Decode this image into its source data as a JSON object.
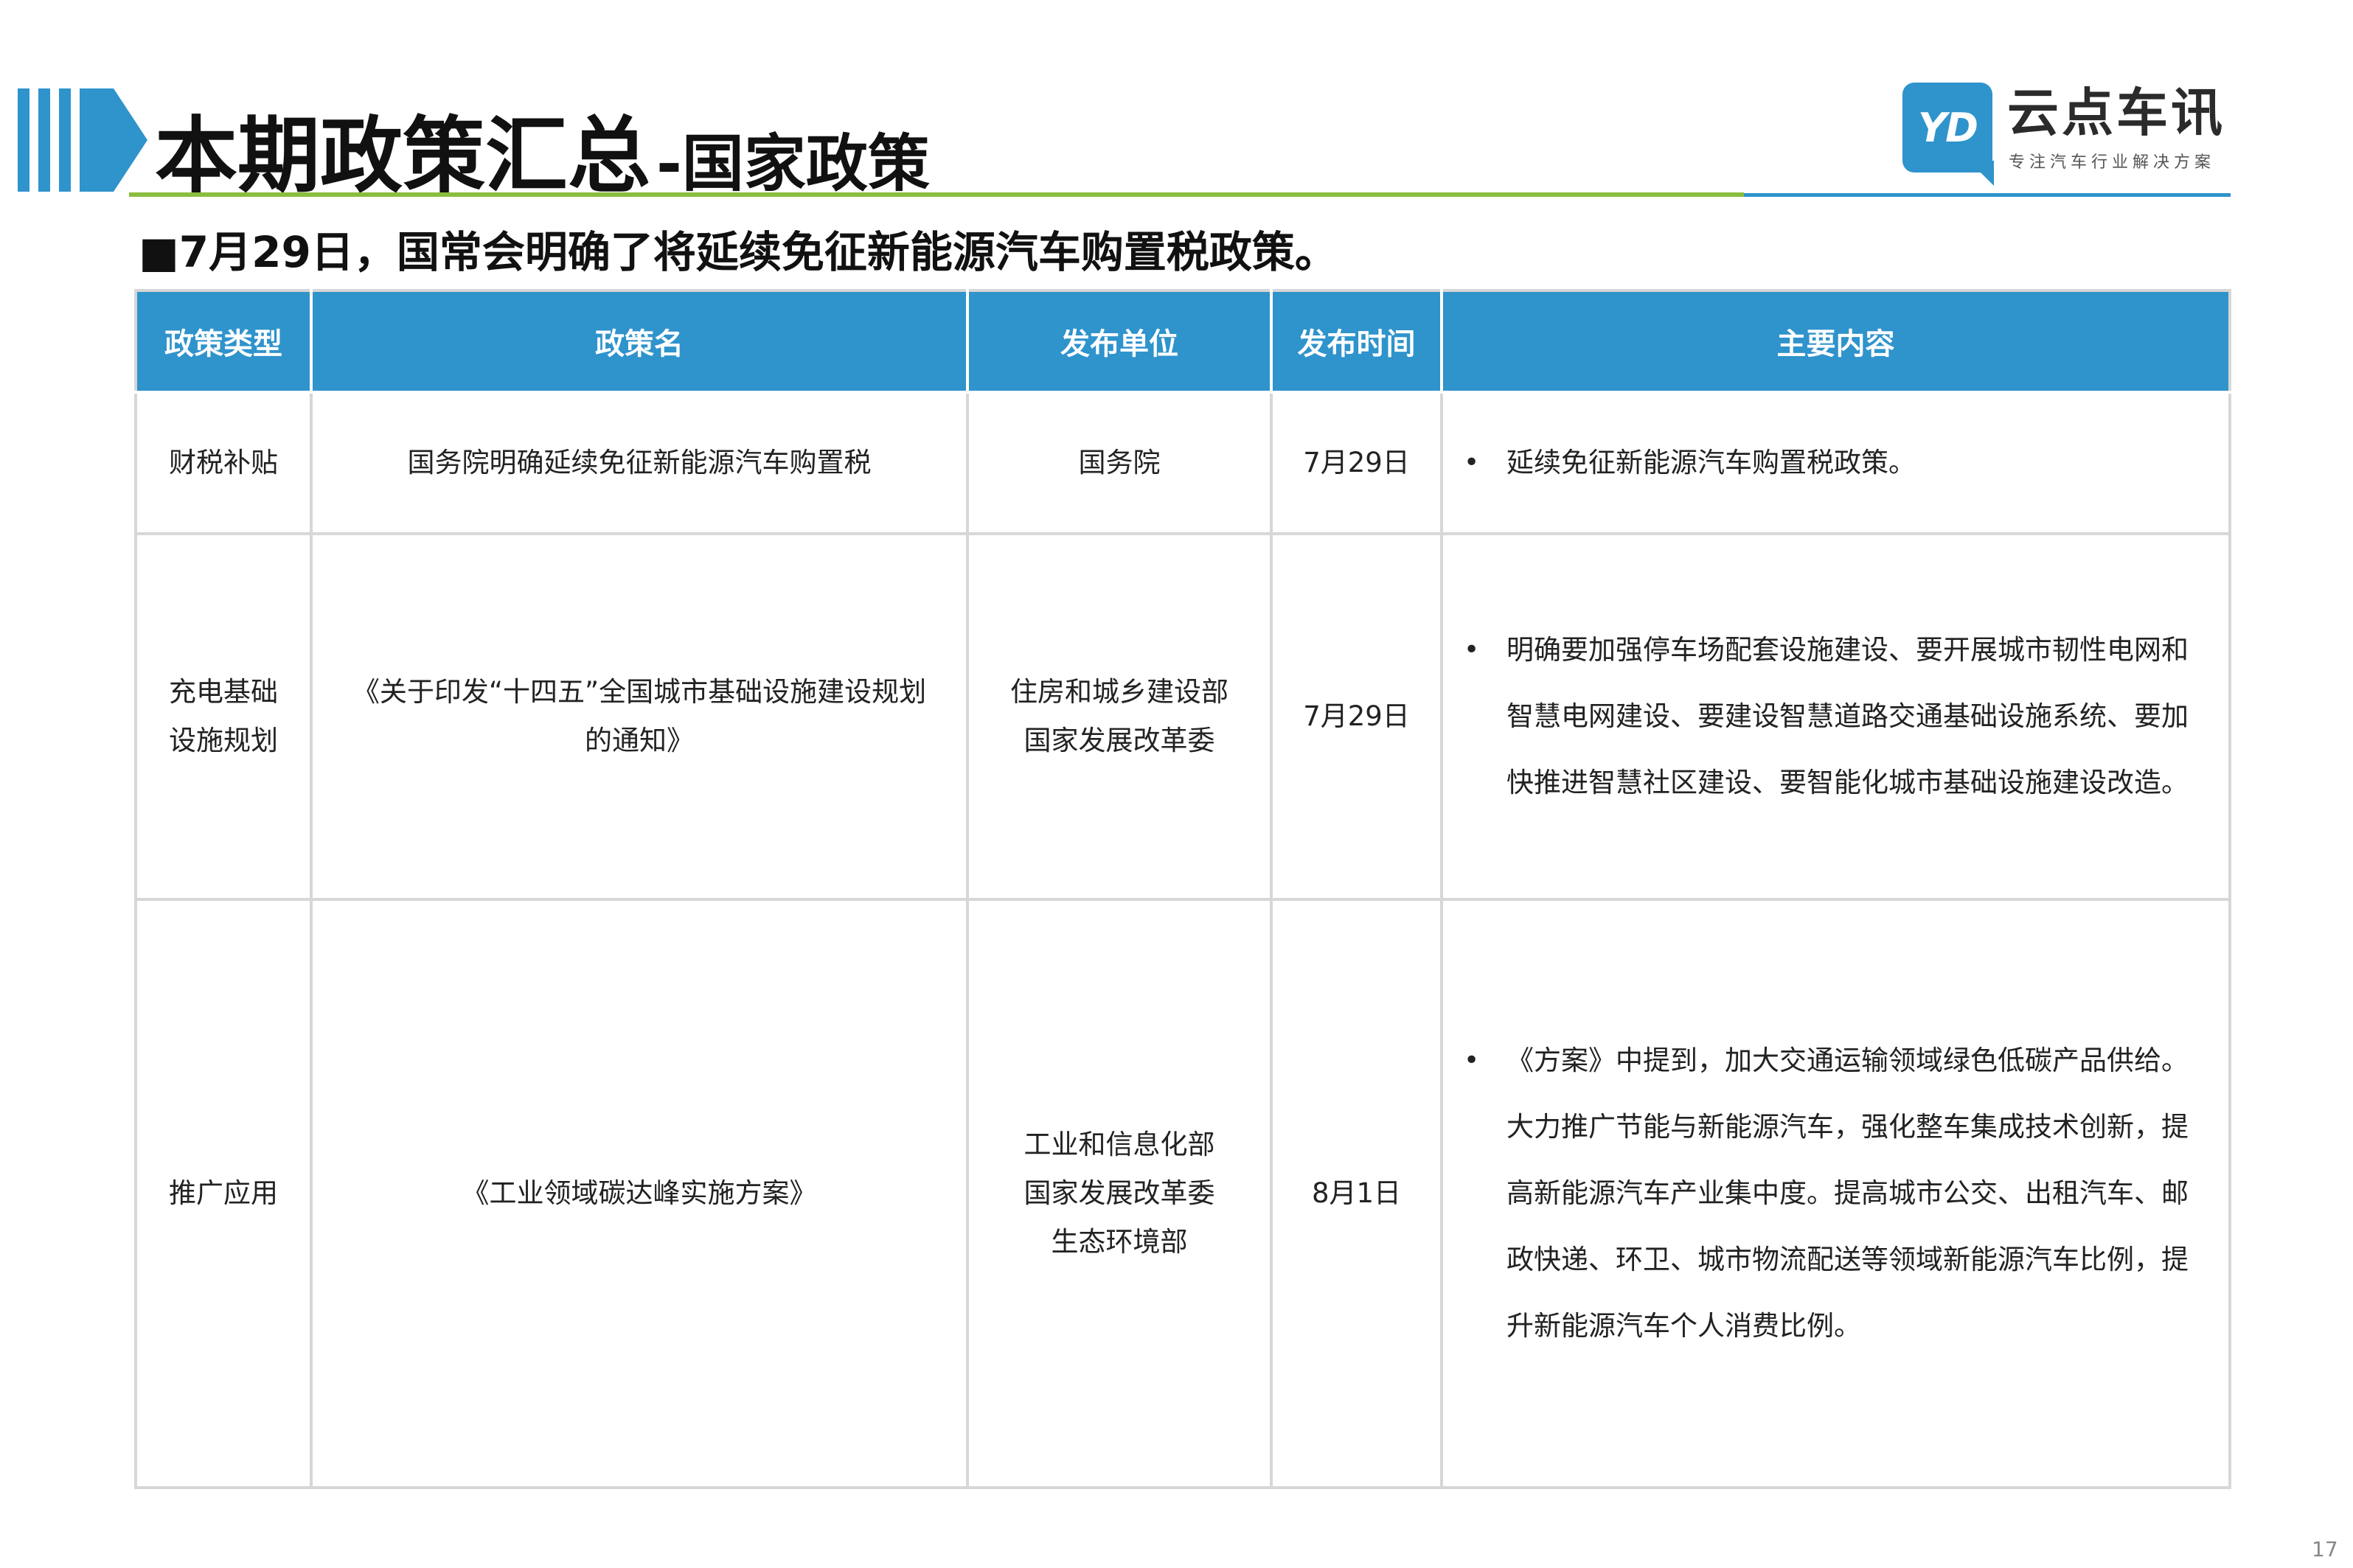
{
  "header": {
    "title_main": "本期政策汇总",
    "title_sub": "-国家政策"
  },
  "logo": {
    "mark": "YD",
    "name": "云点车讯",
    "slogan": "专注汽车行业解决方案"
  },
  "subtitle": "■7月29日，国常会明确了将延续免征新能源汽车购置税政策。",
  "table": {
    "headers": [
      "政策类型",
      "政策名",
      "发布单位",
      "发布时间",
      "主要内容"
    ],
    "rows": [
      {
        "type": [
          "财税补贴"
        ],
        "name": [
          "国务院明确延续免征新能源汽车购置税"
        ],
        "issuer": [
          "国务院"
        ],
        "date": "7月29日",
        "content": [
          "延续免征新能源汽车购置税政策。"
        ]
      },
      {
        "type": [
          "充电基础",
          "设施规划"
        ],
        "name": [
          "《关于印发“十四五”全国城市基础设施建设规划",
          "的通知》"
        ],
        "issuer": [
          "住房和城乡建设部",
          "国家发展改革委"
        ],
        "date": "7月29日",
        "content": [
          "明确要加强停车场配套设施建设、要开展城市韧性电网和智慧电网建设、要建设智慧道路交通基础设施系统、要加快推进智慧社区建设、要智能化城市基础设施建设改造。"
        ]
      },
      {
        "type": [
          "推广应用"
        ],
        "name": [
          "《工业领域碳达峰实施方案》"
        ],
        "issuer": [
          "工业和信息化部",
          "国家发展改革委",
          "生态环境部"
        ],
        "date": "8月1日",
        "content": [
          "《方案》中提到，加大交通运输领域绿色低碳产品供给。大力推广节能与新能源汽车，强化整车集成技术创新，提高新能源汽车产业集中度。提高城市公交、出租汽车、邮政快递、环卫、城市物流配送等领域新能源汽车比例，提升新能源汽车个人消费比例。"
        ]
      }
    ]
  },
  "page_number": "17"
}
